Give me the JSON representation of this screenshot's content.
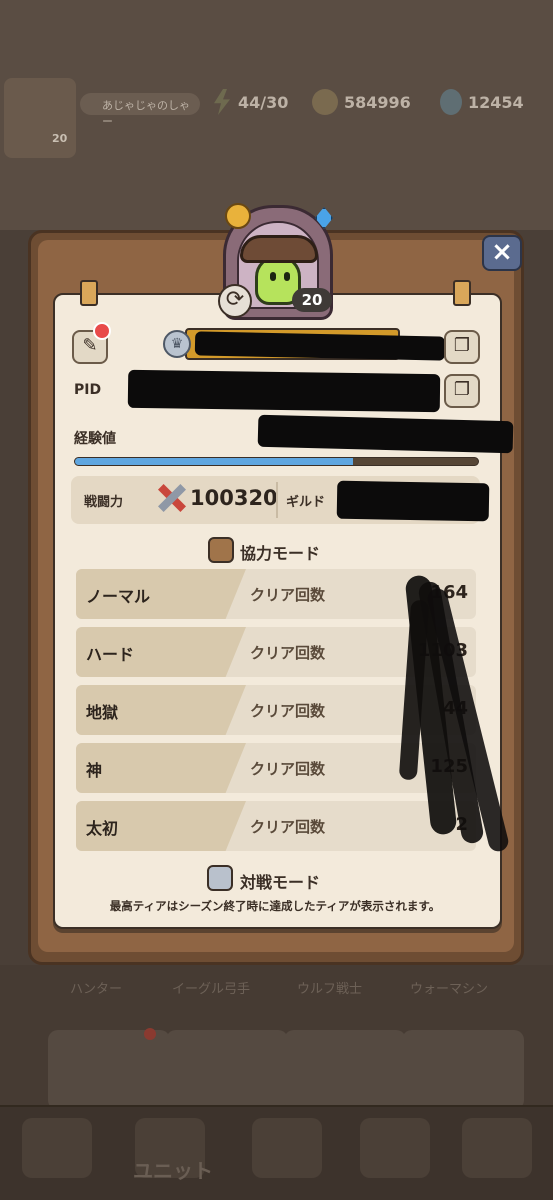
{
  "background": {
    "player_name": "あじゃじゃのしゃー",
    "player_level": "20",
    "stamina": "44/30",
    "gold": "584996",
    "gems": "12454",
    "tabs": [
      "ハンター",
      "イーグル弓手",
      "ウルフ戦士",
      "ウォーマシン"
    ],
    "nav_unit_label": "ユニット"
  },
  "profile": {
    "level": "20",
    "pid_label": "PID",
    "xp_label": "経験値",
    "xp_progress": 0.69,
    "power_label": "戦闘力",
    "power_value": "100320",
    "guild_label": "ギルド",
    "close_label": "×",
    "refresh_icon": "⟳",
    "edit_icon": "✎",
    "copy_icon": "❐"
  },
  "coop": {
    "title": "協力モード",
    "clear_label": "クリア回数",
    "modes": [
      {
        "name": "ノーマル",
        "count": "164"
      },
      {
        "name": "ハード",
        "count": "1103"
      },
      {
        "name": "地獄",
        "count": "44"
      },
      {
        "name": "神",
        "count": "125"
      },
      {
        "name": "太初",
        "count": "2"
      }
    ]
  },
  "pvp": {
    "title": "対戦モード",
    "note": "最高ティアはシーズン終了時に達成したティアが表示されます。"
  },
  "colors": {
    "paper": "#f3eadb",
    "frame": "#6e4d33",
    "xp_fill": "#5fa6e0",
    "close": "#5b6b8f"
  }
}
